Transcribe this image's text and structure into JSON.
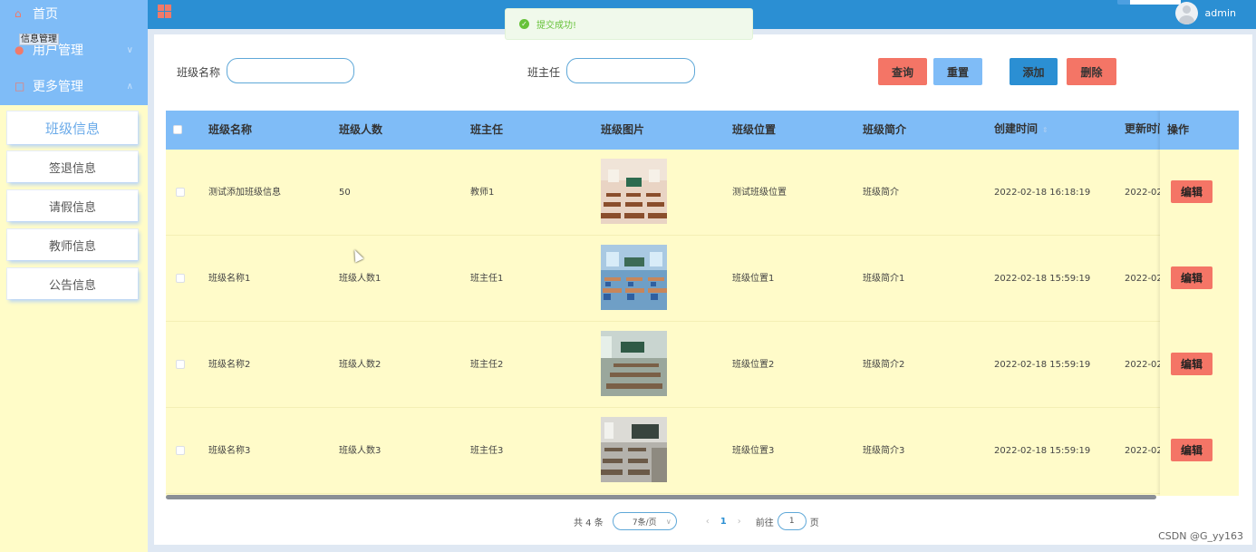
{
  "sidebar": {
    "home": {
      "label": "首页",
      "icon": "home-icon"
    },
    "user_mgmt": {
      "label": "用户管理",
      "icon": "user-icon"
    },
    "more_mgmt": {
      "label": "更多管理",
      "icon": "stack-icon"
    },
    "ghost_label": "信息管理",
    "submenu": [
      {
        "label": "班级信息"
      },
      {
        "label": "签退信息"
      },
      {
        "label": "请假信息"
      },
      {
        "label": "教师信息"
      },
      {
        "label": "公告信息"
      }
    ]
  },
  "header": {
    "username": "admin",
    "accent": "#2b8fd3"
  },
  "toast": {
    "message": "提交成功!"
  },
  "search": {
    "class_name_label": "班级名称",
    "teacher_label": "班主任",
    "class_name_value": "",
    "teacher_value": ""
  },
  "buttons": {
    "query": "查询",
    "reset": "重置",
    "add": "添加",
    "delete": "删除"
  },
  "table": {
    "headers": {
      "name": "班级名称",
      "count": "班级人数",
      "teacher": "班主任",
      "image": "班级图片",
      "location": "班级位置",
      "intro": "班级简介",
      "created": "创建时间",
      "updated": "更新时间",
      "ops": "操作"
    },
    "rows": [
      {
        "name": "测试添加班级信息",
        "count": "50",
        "teacher": "教师1",
        "location": "测试班级位置",
        "intro": "班级简介",
        "created": "2022-02-18 16:18:19",
        "updated": "2022-02-",
        "edit": "编辑"
      },
      {
        "name": "班级名称1",
        "count": "班级人数1",
        "teacher": "班主任1",
        "location": "班级位置1",
        "intro": "班级简介1",
        "created": "2022-02-18 15:59:19",
        "updated": "2022-02-",
        "edit": "编辑"
      },
      {
        "name": "班级名称2",
        "count": "班级人数2",
        "teacher": "班主任2",
        "location": "班级位置2",
        "intro": "班级简介2",
        "created": "2022-02-18 15:59:19",
        "updated": "2022-02-",
        "edit": "编辑"
      },
      {
        "name": "班级名称3",
        "count": "班级人数3",
        "teacher": "班主任3",
        "location": "班级位置3",
        "intro": "班级简介3",
        "created": "2022-02-18 15:59:19",
        "updated": "2022-02-",
        "edit": "编辑"
      }
    ]
  },
  "pagination": {
    "total": "共 4 条",
    "page_size": "7条/页",
    "current_page": "1",
    "goto_prefix": "前往",
    "goto_value": "1",
    "goto_suffix": "页"
  },
  "watermark": "CSDN @G_yy163"
}
